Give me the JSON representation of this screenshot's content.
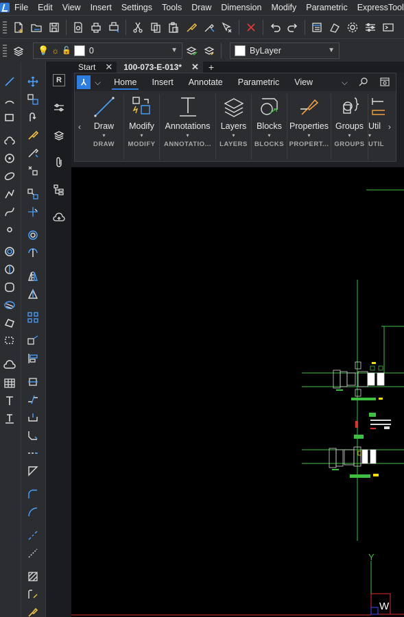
{
  "menu": [
    "File",
    "Edit",
    "View",
    "Insert",
    "Settings",
    "Tools",
    "Draw",
    "Dimension",
    "Modify",
    "Parametric",
    "ExpressTools"
  ],
  "layer": {
    "name": "0"
  },
  "color_combo": {
    "value": "ByLayer"
  },
  "doc_tabs": [
    {
      "label": "Start"
    },
    {
      "label": "100-073-E-013*"
    }
  ],
  "sidepanel": {
    "r_label": "R"
  },
  "ribbon": {
    "tabs": [
      "Home",
      "Insert",
      "Annotate",
      "Parametric",
      "View"
    ],
    "panels": [
      {
        "label": "Draw",
        "title": "DRAW"
      },
      {
        "label": "Modify",
        "title": "MODIFY"
      },
      {
        "label": "Annotations",
        "title": "ANNOTATIO..."
      },
      {
        "label": "Layers",
        "title": "LAYERS"
      },
      {
        "label": "Blocks",
        "title": "BLOCKS"
      },
      {
        "label": "Properties",
        "title": "PROPERT..."
      },
      {
        "label": "Groups",
        "title": "GROUPS"
      },
      {
        "label": "Util",
        "title": "UTIL"
      }
    ]
  },
  "ucs": {
    "y_label": "Y",
    "w_label": "W"
  },
  "colors": {
    "accent": "#2f7de1",
    "canvas_bg": "#000000",
    "cad_green": "#3fbf3f",
    "cad_yellow": "#f0e000",
    "cad_red": "#e03030"
  }
}
